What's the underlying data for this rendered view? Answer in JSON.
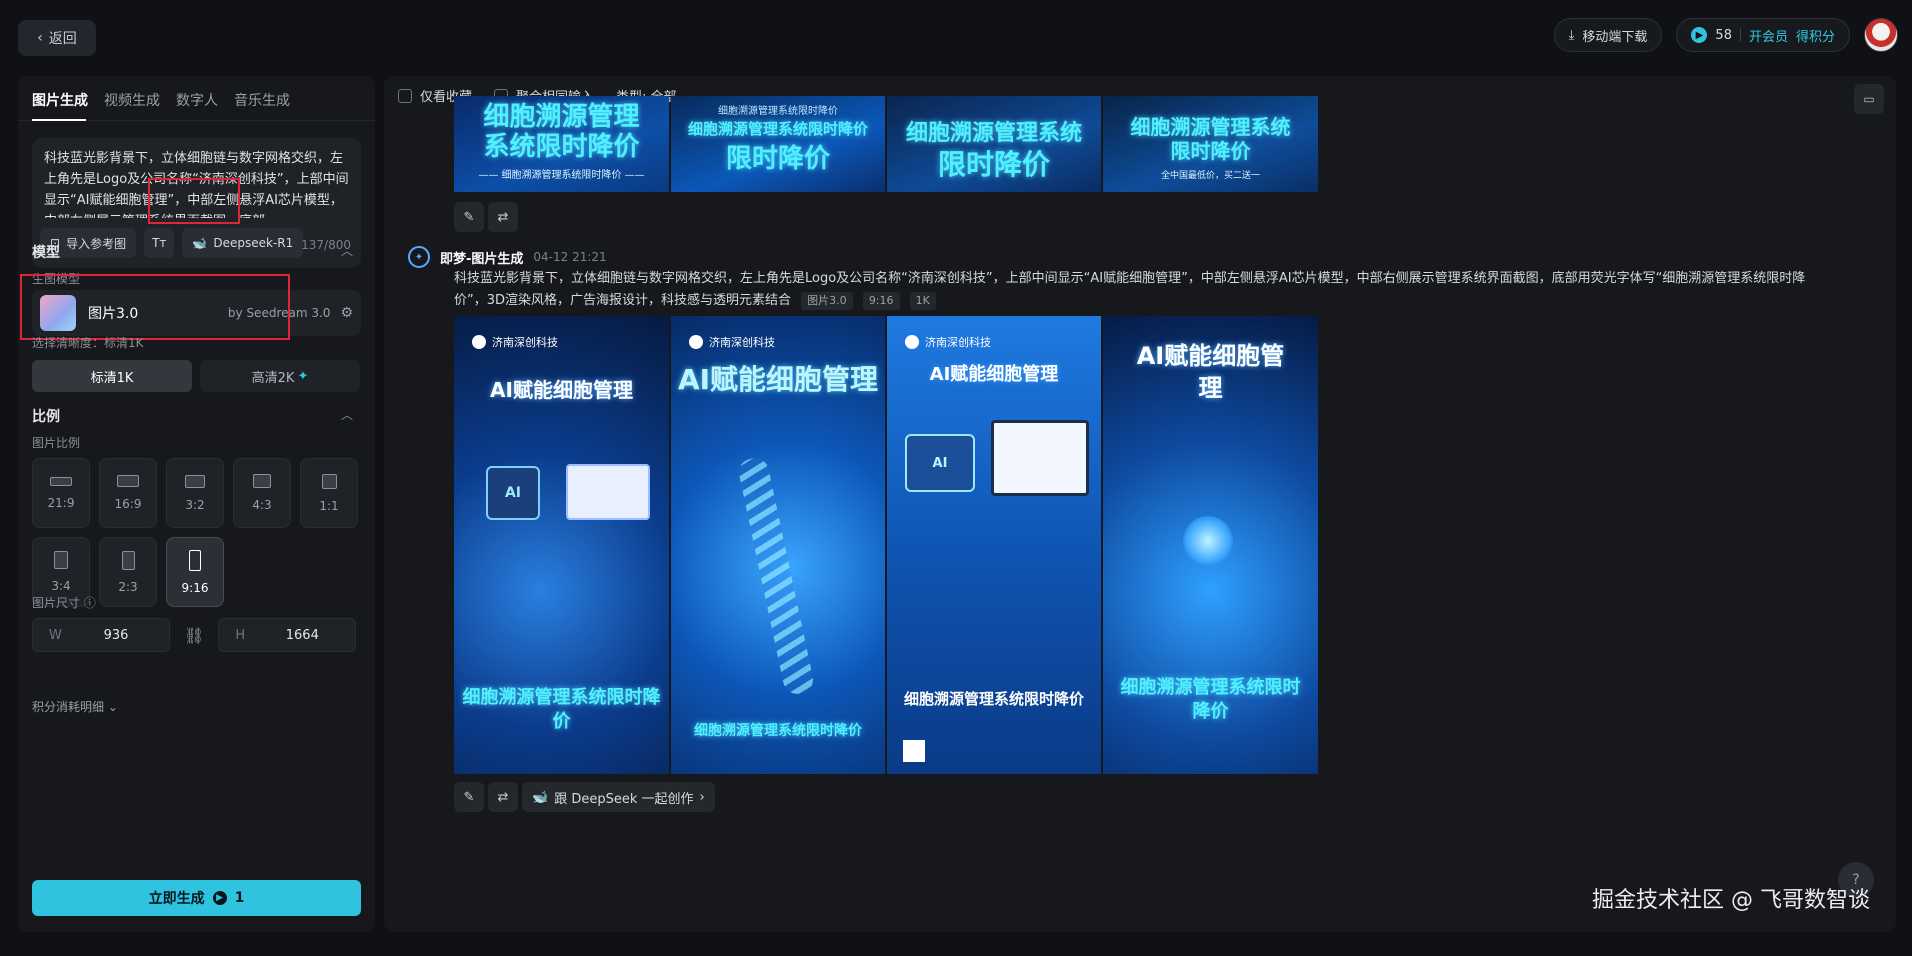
{
  "topbar": {
    "back_label": "返回",
    "download_label": "移动端下载",
    "credits": "58",
    "vip_label": "开会员",
    "earn_label": "得积分"
  },
  "sidebar": {
    "tabs": [
      "图片生成",
      "视频生成",
      "数字人",
      "音乐生成"
    ],
    "prompt": "科技蓝光影背景下，立体细胞链与数字网格交织，左上角先是Logo及公司名称“济南深创科技”，上部中间显示“AI赋能细胞管理”，中部左侧悬浮AI芯片模型，中部右侧展示管理系统界面截图，底部",
    "import_ref": "导入参考图",
    "model_chip": "Deepseek-R1",
    "char_count": "137/800",
    "model_section": "模型",
    "gen_model_label": "生图模型",
    "model_name": "图片3.0",
    "model_by": "by Seedream 3.0",
    "quality_label": "选择清晰度：标清1K",
    "quality_options": [
      "标清1K",
      "高清2K"
    ],
    "ratio_section": "比例",
    "ratio_label": "图片比例",
    "ratios": [
      "21:9",
      "16:9",
      "3:2",
      "4:3",
      "1:1",
      "3:4",
      "2:3",
      "9:16"
    ],
    "size_label": "图片尺寸",
    "width_label": "W",
    "width_value": "936",
    "height_label": "H",
    "height_value": "1664",
    "cost_detail": "积分消耗明细",
    "generate_label": "立即生成",
    "generate_cost": "1"
  },
  "main": {
    "filters": {
      "favorites": "仅看收藏",
      "merge": "聚合相同输入",
      "type": "类型: 全部"
    },
    "top_posters": [
      {
        "line1": "细胞溯源管理",
        "line2": "系统限时降价",
        "sub": "—— 细胞溯源管理系统限时降价 ——"
      },
      {
        "line1": "细胞溯源管理系统限时降价",
        "line2": "限时降价",
        "sub": "细胞溯源管理系统限时降价"
      },
      {
        "line1": "细胞溯源管理系统",
        "line2": "限时降价",
        "sub": ""
      },
      {
        "line1": "细胞溯源管理系统",
        "line2": "限时降价",
        "sub": "全中国最低价，买二送一"
      }
    ],
    "gen": {
      "source": "即梦-图片生成",
      "time": "04-12 21:21",
      "prompt": "科技蓝光影背景下，立体细胞链与数字网格交织，左上角先是Logo及公司名称“济南深创科技”，上部中间显示“AI赋能细胞管理”，中部左侧悬浮AI芯片模型，中部右侧展示管理系统界面截图，底部用荧光字体写“细胞溯源管理系统限时降价”，3D渲染风格，广告海报设计，科技感与透明元素结合",
      "tags": [
        "图片3.0",
        "9:16",
        "1K"
      ],
      "posters": [
        {
          "brand": "济南深创科技",
          "headline": "AI赋能细胞管理",
          "footer": "细胞溯源管理系统限时降价"
        },
        {
          "brand": "济南深创科技",
          "headline": "AI赋能细胞管理",
          "footer": "细胞溯源管理系统限时降价"
        },
        {
          "brand": "济南深创科技",
          "headline": "AI赋能细胞管理",
          "footer": "细胞溯源管理系统限时降价"
        },
        {
          "brand": "",
          "headline": "AI赋能细胞管理",
          "footer": "细胞溯源管理系统限时降价"
        }
      ],
      "deepseek_label": "跟 DeepSeek 一起创作"
    },
    "watermark": "掘金技术社区 @ 飞哥数智谈"
  },
  "colors": {
    "accent": "#2fc3e0",
    "highlight_box": "#e0243a"
  }
}
